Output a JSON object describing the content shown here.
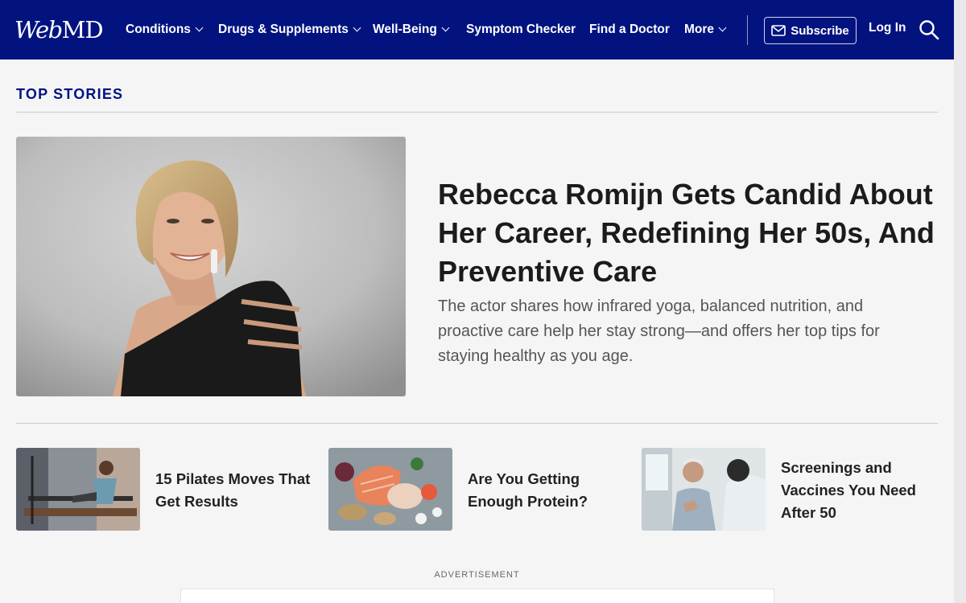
{
  "header": {
    "logo_web": "Web",
    "logo_md": "MD",
    "nav": [
      {
        "label": "Conditions",
        "dropdown": true
      },
      {
        "label": "Drugs & Supplements",
        "dropdown": true
      },
      {
        "label": "Well-Being",
        "dropdown": true
      },
      {
        "label": "Symptom Checker",
        "dropdown": false
      },
      {
        "label": "Find a Doctor",
        "dropdown": false
      },
      {
        "label": "More",
        "dropdown": true
      }
    ],
    "subscribe_label": "Subscribe",
    "login_label": "Log In",
    "background_color": "#021380"
  },
  "top_stories": {
    "section_title": "TOP STORIES",
    "hero": {
      "title": "Rebecca Romijn Gets Candid About Her Career, Redefining Her 50s, And Preventive Care",
      "description": "The actor shares how infrared yoga, balanced nutrition, and proactive care help her stay strong—and offers her top tips for staying healthy as you age."
    },
    "cards": [
      {
        "title": "15 Pilates Moves That Get Results"
      },
      {
        "title": "Are You Getting Enough Protein?"
      },
      {
        "title": "Screenings and Vaccines You Need After 50"
      }
    ]
  },
  "advertisement": {
    "label": "ADVERTISEMENT"
  }
}
